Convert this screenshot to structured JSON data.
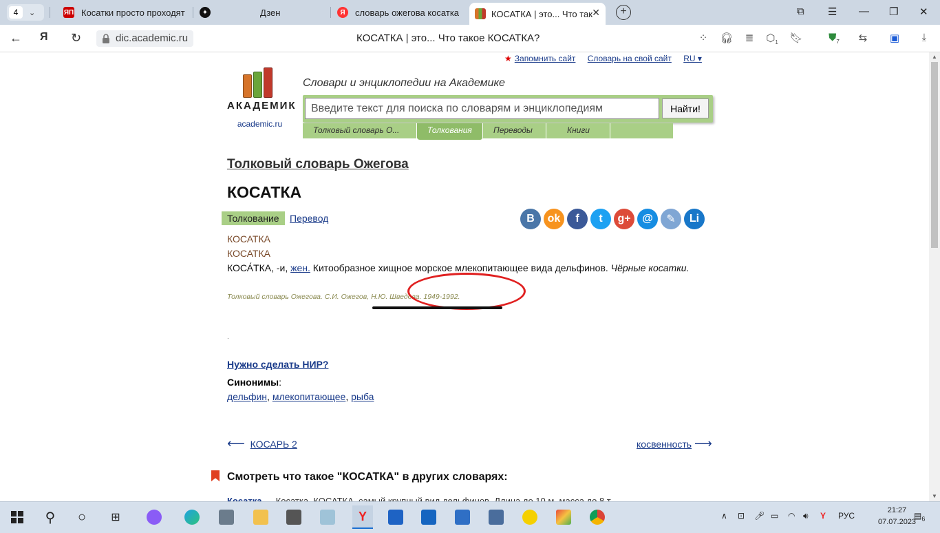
{
  "browser": {
    "tab_count": "4",
    "tabs": [
      {
        "title": "Косатки просто проходят"
      },
      {
        "title": "Дзен"
      },
      {
        "title": "словарь ожегова косатка"
      },
      {
        "title": "КОСАТКА | это... Что так"
      }
    ],
    "url": "dic.academic.ru",
    "page_title": "КОСАТКА | это... Что такое КОСАТКА?",
    "extension_badge_1": "1",
    "extension_badge_2": "7"
  },
  "site": {
    "toplinks": {
      "remember": "Запомнить сайт",
      "dict_for_site": "Словарь на свой сайт",
      "lang": "RU ▾"
    },
    "logo_text": "АКАДЕМИК",
    "logo_url": "academic.ru",
    "tagline": "Словари и энциклопедии на Академике",
    "search_placeholder": "Введите текст для поиска по словарям и энциклопедиям",
    "search_button": "Найти!",
    "search_tabs": [
      "Толковый словарь О...",
      "Толкования",
      "Переводы",
      "Книги"
    ]
  },
  "article": {
    "dictionary_title": "Толковый словарь Ожегова",
    "headword": "КОСАТКА",
    "mode_active": "Толкование",
    "mode_link": "Перевод",
    "entry_line1": "КОСАТКА",
    "entry_line2": "КОСАТКА",
    "def_head": "КОСА́ТКА, -и, ",
    "def_gender": "жен.",
    "def_text": " Китообразное хищное морское млекопитающее вида дельфинов. ",
    "def_example": "Чёрные косатки.",
    "source": "Толковый словарь Ожегова. С.И. Ожегов, Н.Ю. Шведова. 1949-1992.",
    "nir_link": "Нужно сделать НИР?",
    "synonyms_label": "Синонимы",
    "synonyms": [
      "дельфин",
      "млекопитающее",
      "рыба"
    ],
    "prev": "КОСАРЬ 2",
    "next": "косвенность",
    "other_title": "Смотреть что такое \"КОСАТКА\" в других словарях:",
    "cut_word": "Косатка",
    "cut_text": " — Косатка, КОСАТКА, самый крупный вид дельфинов. Длина до 10 м, масса до 8 т."
  },
  "social": [
    {
      "label": "В",
      "color": "#4a76a8"
    },
    {
      "label": "ok",
      "color": "#f7931e"
    },
    {
      "label": "f",
      "color": "#3b5998"
    },
    {
      "label": "t",
      "color": "#1da1f2"
    },
    {
      "label": "g+",
      "color": "#dd4b39"
    },
    {
      "label": "@",
      "color": "#168de2"
    },
    {
      "label": "✎",
      "color": "#7fa6d4"
    },
    {
      "label": "Li",
      "color": "#1877c9"
    }
  ],
  "taskbar": {
    "lang": "РУС",
    "time": "21:27",
    "date": "07.07.2023",
    "notif_count": "6"
  }
}
